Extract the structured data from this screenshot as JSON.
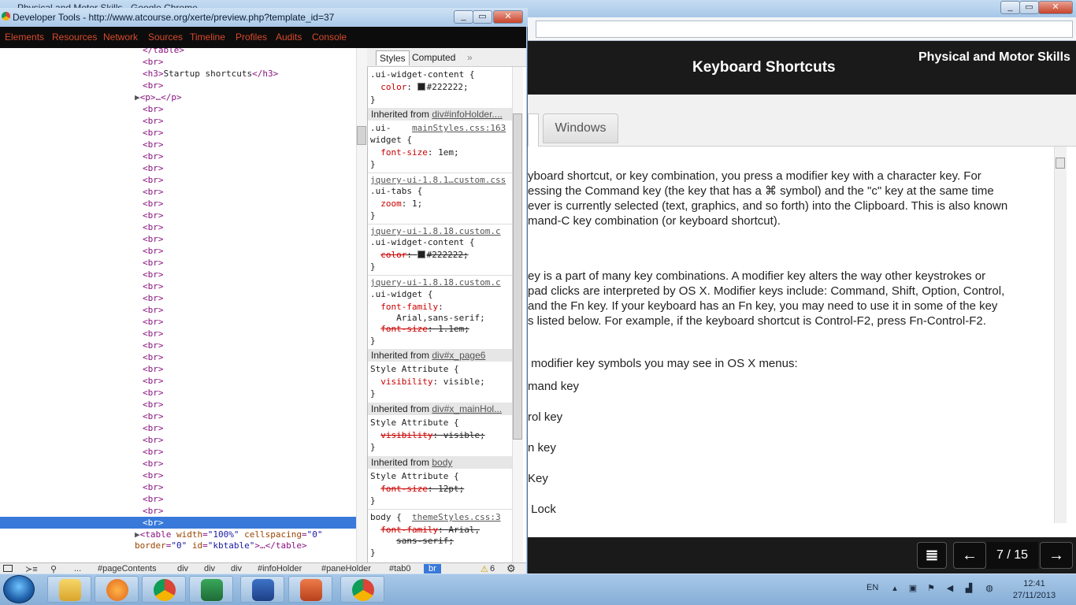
{
  "chrome": {
    "title": "Physical and Motor Skills - Google Chrome",
    "minimize": "_",
    "maximize": "▭",
    "close": "✕"
  },
  "page": {
    "title": "Keyboard Shortcuts",
    "subject": "Physical and Motor Skills",
    "tab_windows": "Windows",
    "paragraphs": [
      "yboard shortcut, or key combination, you press a modifier key with a character key. For",
      "essing the Command key (the key that has a ⌘ symbol) and the \"c\" key at the same time",
      "ever is currently selected (text, graphics, and so forth) into the Clipboard. This is also known",
      "mand-C key combination (or keyboard shortcut).",
      "ey is a part of many key combinations. A modifier key alters the way other keystrokes or",
      "pad clicks are interpreted by OS X. Modifier keys include: Command, Shift, Option, Control,",
      "and the Fn key. If your keyboard has an Fn key, you may need to use it in some of the key",
      "s listed below. For example, if the keyboard shortcut is Control-F2, press Fn-Control-F2.",
      " modifier key symbols you may see in OS X menus:",
      "mand key",
      "rol key",
      "n key",
      "Key",
      " Lock"
    ],
    "counter": "7 / 15",
    "menu_icon": "≣",
    "prev": "←",
    "next": "→"
  },
  "devtools": {
    "title": "Developer Tools - http://www.atcourse.org/xerte/preview.php?template_id=37",
    "minimize": "_",
    "maximize": "▭",
    "close": "✕",
    "tabs": [
      "Elements",
      "Resources",
      "Network",
      "Sources",
      "Timeline",
      "Profiles",
      "Audits",
      "Console"
    ],
    "dom": {
      "close_table": "</table>",
      "br": "<br>",
      "h3_open": "<h3>",
      "h3_text": "Startup shortcuts",
      "h3_close": "</h3>",
      "p_collapsed": "<p>…</p>",
      "table_tag": "<table",
      "attr_width": "width",
      "val_width": "\"100%\"",
      "attr_cellspacing": "cellspacing",
      "val_cellspacing": "\"0\"",
      "attr_border": "border",
      "val_border": "\"0\"",
      "attr_id": "id",
      "val_id": "\"kbtable\"",
      "table_end": ">…</table>"
    },
    "styles_tabs": {
      "styles": "Styles",
      "computed": "Computed",
      "more": "»"
    },
    "styles": {
      "r1_sel": ".ui-widget-content {",
      "r1_prop": "color",
      "r1_val": "#222222;",
      "close": "}",
      "inh1_prefix": "Inherited from ",
      "inh1_link": "div#infoHolder....",
      "r2_sel": ".ui-",
      "r2_src": "mainStyles.css:163",
      "r2_sel2": "widget {",
      "r2_prop": "font-size",
      "r2_val": "1em;",
      "r3_src": "jquery-ui-1.8.1…custom.css",
      "r3_sel": ".ui-tabs {",
      "r3_prop": "zoom",
      "r3_val": "1;",
      "r4_src": "jquery-ui-1.8.18.custom.c",
      "r4_sel": ".ui-widget-content {",
      "r4_prop": "color",
      "r4_val": "#222222;",
      "r5_src": "jquery-ui-1.8.18.custom.c",
      "r5_sel": ".ui-widget {",
      "r5_prop": "font-family",
      "r5_val": "Arial,sans-serif;",
      "r5_prop2": "font-size",
      "r5_val2": "1.1em;",
      "inh2_link": "div#x_page6",
      "style_attr": "Style Attribute {",
      "r6_prop": "visibility",
      "r6_val": "visible;",
      "inh3_link": "div#x_mainHol...",
      "r7_prop": "visibility",
      "r7_val": "visible;",
      "inh4_link": "body",
      "r8_prop": "font-size",
      "r8_val": "12pt;",
      "r9_sel": "body {",
      "r9_src": "themeStyles.css:3",
      "r9_prop": "font-family",
      "r9_val": "Arial,",
      "r9_val2": "sans-serif;"
    },
    "breadcrumbs": [
      "...",
      "#pageContents",
      "div",
      "div",
      "div",
      "#infoHolder",
      "#paneHolder",
      "#tab0",
      "br"
    ],
    "warnings_count": "6"
  },
  "taskbar": {
    "apps": [
      "explorer-icon",
      "media-player-icon",
      "chrome-icon",
      "excel-icon",
      "word-icon",
      "powerpoint-icon",
      "chrome-icon"
    ],
    "language": "EN",
    "time": "12:41",
    "date": "27/11/2013"
  },
  "colors": {
    "devtools_tab_text": "#d64a2b",
    "selection": "#3879d9",
    "page_header": "#1a1a1a"
  }
}
